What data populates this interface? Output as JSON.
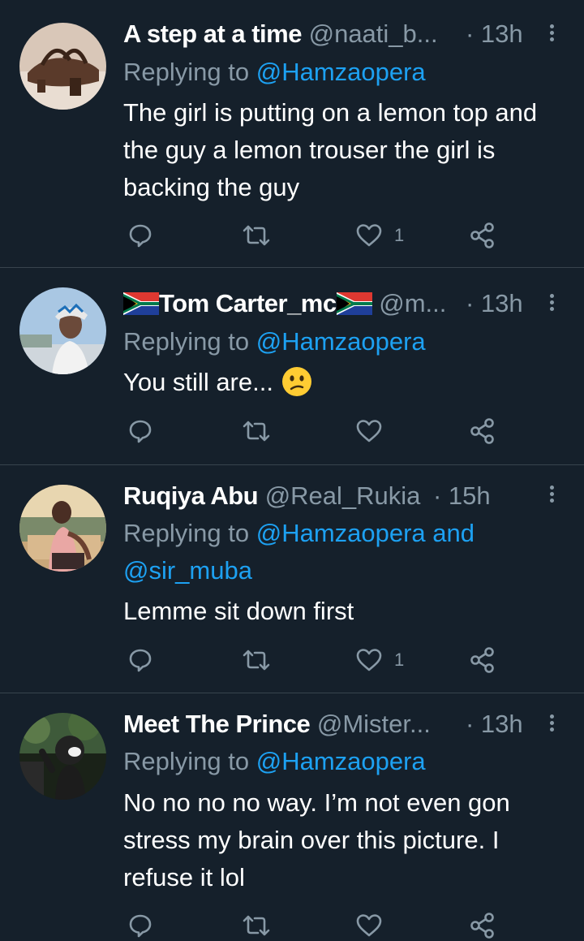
{
  "colors": {
    "background": "#15202b",
    "divider": "#38444d",
    "secondary_text": "#8899a6",
    "mention": "#1da1f2",
    "primary_text": "#ffffff"
  },
  "tweets": [
    {
      "display_name": "A step at a time",
      "handle": "@naati_b...",
      "time": "· 13h",
      "replying_prefix": "Replying to",
      "replying_to": "@Hamzaopera",
      "text": "The girl is putting on a lemon top and the guy a lemon trouser the girl is backing the guy",
      "like_count": "1",
      "icons": [
        "reply-icon",
        "retweet-icon",
        "like-icon",
        "share-icon",
        "more-icon"
      ]
    },
    {
      "display_name": "Tom Carter_mc",
      "handle": "@m...",
      "time": "· 13h",
      "replying_prefix": "Replying to",
      "replying_to": "@Hamzaopera",
      "text": "You still are...",
      "emoji": "confused-face",
      "name_flags": "south-africa-flag",
      "like_count": ""
    },
    {
      "display_name": "Ruqiya Abu",
      "handle": "@Real_Rukia",
      "time": "· 15h",
      "replying_prefix": "Replying to",
      "replying_to": "@Hamzaopera and @sir_muba",
      "replying_to_1": "@Hamzaopera and",
      "replying_to_2": "@sir_muba",
      "text": "Lemme sit down first",
      "like_count": "1"
    },
    {
      "display_name": "Meet The Prince",
      "handle": "@Mister...",
      "time": "· 13h",
      "replying_prefix": "Replying to",
      "replying_to": "@Hamzaopera",
      "text": "No no no no way. I’m not even gon stress my brain over this picture. I refuse it lol",
      "like_count": ""
    }
  ]
}
